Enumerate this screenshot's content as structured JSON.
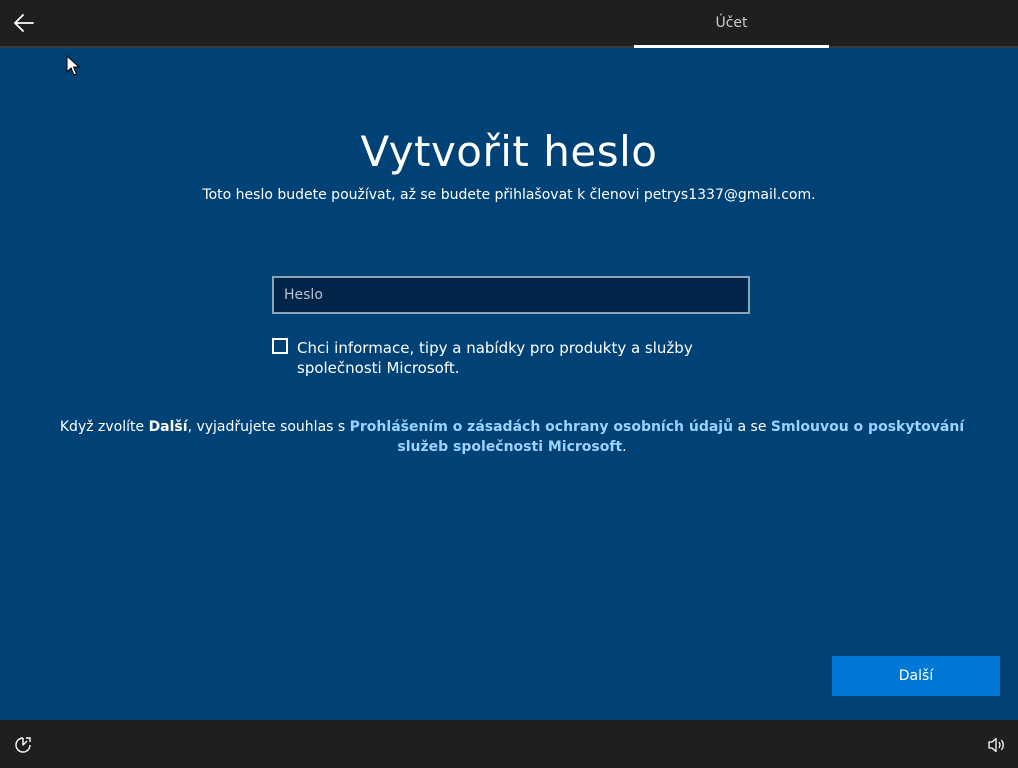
{
  "header": {
    "back_icon": "arrow-left-icon",
    "tab_label": "Účet"
  },
  "main": {
    "title": "Vytvořit heslo",
    "subtitle": "Toto heslo budete používat, až se budete přihlašovat k členovi petrys1337@gmail.com.",
    "password": {
      "placeholder": "Heslo",
      "value": ""
    },
    "marketing_checkbox": {
      "checked": false,
      "label": "Chci informace, tipy a nabídky pro produkty a služby společnosti Microsoft."
    },
    "consent": {
      "prefix": "Když zvolíte ",
      "next_word": "Další",
      "middle": ", vyjadřujete souhlas s ",
      "privacy_link": "Prohlášením o zásadách ochrany osobních údajů",
      "conjunction": " a se ",
      "services_link": "Smlouvou o poskytování služeb společnosti Microsoft",
      "suffix": "."
    },
    "next_button": "Další"
  },
  "footer": {
    "ease_icon": "ease-of-access-icon",
    "volume_icon": "volume-icon"
  },
  "colors": {
    "background": "#004275",
    "bar": "#1f1f1f",
    "accent_button": "#0078d7",
    "link": "#9dd1ff",
    "input_background": "#002548"
  }
}
